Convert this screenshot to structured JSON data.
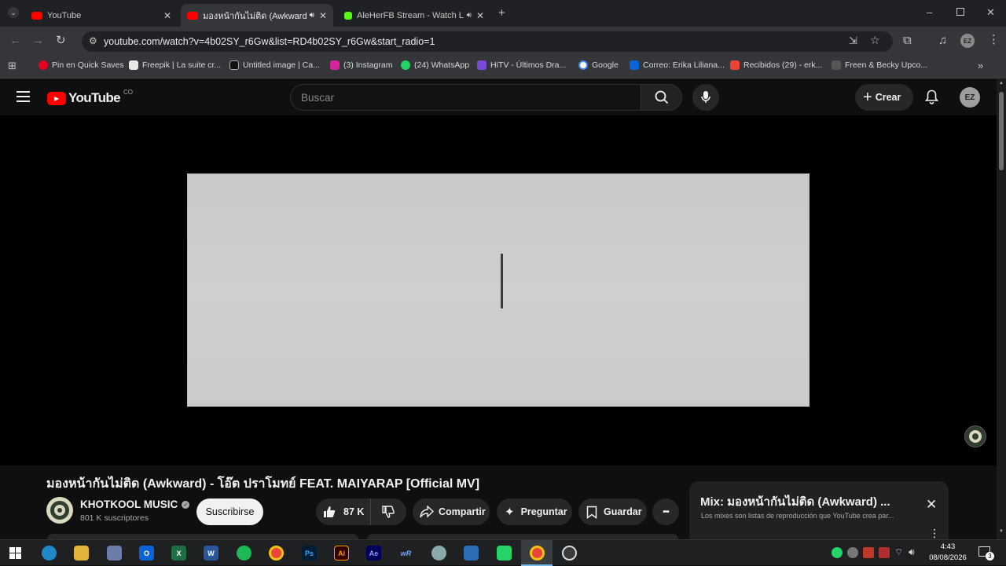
{
  "browser": {
    "tabs": [
      {
        "title": "YouTube",
        "favicon_color": "#ff0000"
      },
      {
        "title": "มองหน้ากันไม่ติด (Awkward) -",
        "favicon_color": "#ff0000"
      },
      {
        "title": "AleHerFB Stream - Watch Li",
        "favicon_color": "#53fc18"
      }
    ],
    "new_tab_label": "+",
    "url": "youtube.com/watch?v=4b02SY_r6Gw&list=RD4b02SY_r6Gw&start_radio=1",
    "bookmarks": [
      {
        "label": "Pin en Quick Saves",
        "color": "#e60023"
      },
      {
        "label": "Freepik | La suite cr...",
        "color": "#1d1d1d"
      },
      {
        "label": "Untitled image | Ca...",
        "color": "#111111"
      },
      {
        "label": "(3) Instagram",
        "color": "#d6249f"
      },
      {
        "label": "(24) WhatsApp",
        "color": "#25d366"
      },
      {
        "label": "HiTV - Últimos Dra...",
        "color": "#7b4bd8"
      },
      {
        "label": "Google",
        "color": "#4285f4"
      },
      {
        "label": "Correo: Erika Liliana...",
        "color": "#0a64d8"
      },
      {
        "label": "Recibidos (29) - erk...",
        "color": "#ea4335"
      },
      {
        "label": "Freen & Becky Upco...",
        "color": "#555555"
      }
    ]
  },
  "youtube": {
    "logo_text": "YouTube",
    "country_code": "CO",
    "search_placeholder": "Buscar",
    "create_label": "Crear",
    "avatar_initials": "EZ",
    "video_title": "มองหน้ากันไม่ติด (Awkward) - โอ๊ต ปราโมทย์ FEAT. MAIYARAP [Official MV]",
    "channel_name": "KHOTKOOL MUSIC",
    "subscribers": "801 K suscriptores",
    "subscribe_label": "Suscribirse",
    "likes": "87 K",
    "share_label": "Compartir",
    "ask_label": "Preguntar",
    "save_label": "Guardar",
    "more_label": "•••",
    "mix": {
      "title": "Mix: มองหน้ากันไม่ติด (Awkward) ...",
      "subtitle": "Los mixes son listas de reproducción que YouTube crea par..."
    }
  },
  "taskbar": {
    "time": "4:43",
    "date": "08/08/2026",
    "notifications": "3"
  }
}
